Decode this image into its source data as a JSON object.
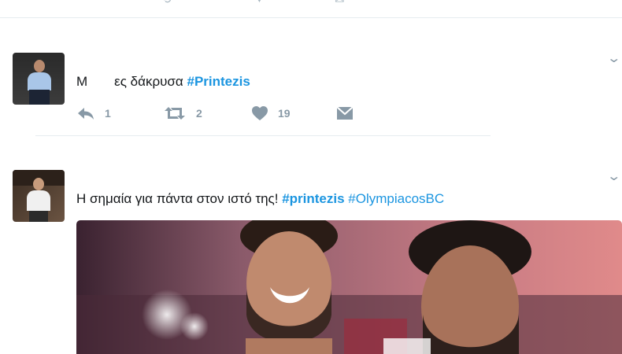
{
  "previous_tweet": {
    "reply_count": "",
    "like_count": ""
  },
  "tweet1": {
    "avatar": "user-avatar",
    "text_prefix": "Μ",
    "text_main": "ες δάκρυσα",
    "hashtag": "#Printezis",
    "actions": {
      "reply_count": "1",
      "retweet_count": "2",
      "like_count": "19"
    }
  },
  "tweet2": {
    "avatar": "user-avatar",
    "text_main": "Η σημαία για πάντα στον ιστό της!",
    "hashtag_bold": "#printezis",
    "hashtag2": "#OlympiacosBC",
    "photo": "basketball-players-celebrating-photo"
  },
  "colors": {
    "link": "#1b95e0",
    "icon": "#8899a6",
    "divider": "#e6ecf0"
  }
}
